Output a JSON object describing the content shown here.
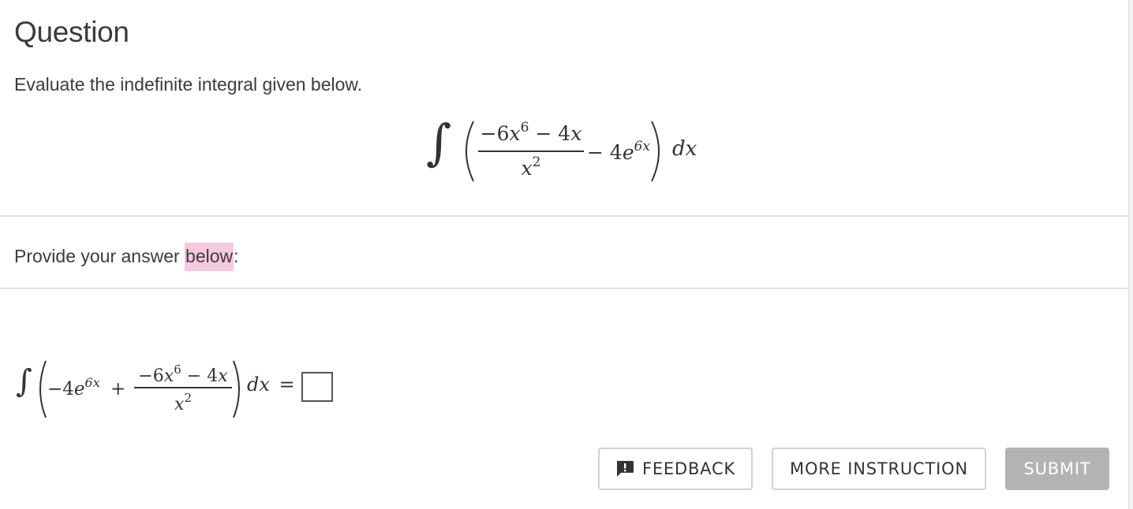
{
  "question": {
    "title": "Question",
    "prompt": "Evaluate the indefinite integral given below.",
    "expression": {
      "integral_sign": "∫",
      "numerator_coef": "−6",
      "numerator_var": "x",
      "numerator_exp": "6",
      "numerator_rest": " − 4",
      "numerator_rest_var": "x",
      "denominator_var": "x",
      "denominator_exp": "2",
      "minus": "−",
      "exp_term_coef": "4",
      "exp_term_base": "e",
      "exp_term_exp": "6x",
      "differential": "dx"
    }
  },
  "answer_section": {
    "provide_prefix": "Provide your answer ",
    "provide_highlight": "below",
    "provide_suffix": ":",
    "expression": {
      "integral_sign": "∫",
      "term1": "−4",
      "term1_base": "e",
      "term1_exp": "6x",
      "plus": "+",
      "numerator_coef": "−6",
      "numerator_var": "x",
      "numerator_exp": "6",
      "numerator_rest": " − 4",
      "numerator_rest_var": "x",
      "denominator_var": "x",
      "denominator_exp": "2",
      "differential": "dx",
      "equals": "="
    }
  },
  "buttons": {
    "feedback": "FEEDBACK",
    "more_instruction": "MORE INSTRUCTION",
    "submit": "SUBMIT"
  },
  "colors": {
    "highlight": "#f5c9e0",
    "submit_disabled": "#b3b3b3"
  }
}
